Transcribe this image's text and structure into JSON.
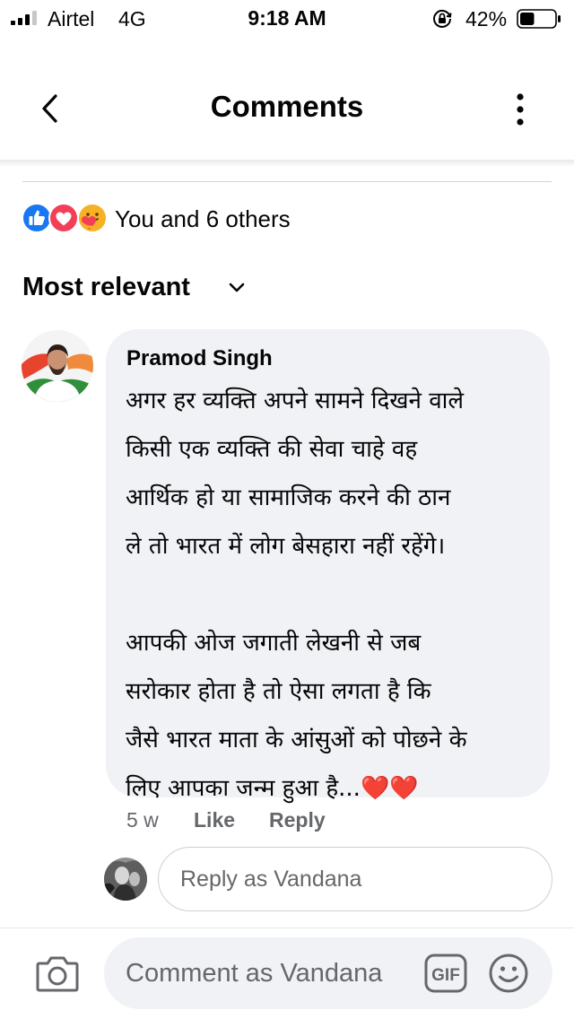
{
  "status_bar": {
    "carrier": "Airtel",
    "network": "4G",
    "time": "9:18 AM",
    "battery_percent": "42%",
    "battery_level": 0.42,
    "signal_bars_filled": 3,
    "signal_bars_total": 4
  },
  "header": {
    "title": "Comments"
  },
  "reactions": {
    "icons": [
      "like-icon",
      "love-icon",
      "care-icon"
    ],
    "text": "You and 6 others"
  },
  "sort": {
    "label": "Most relevant"
  },
  "comment": {
    "author": "Pramod Singh",
    "paragraph1": [
      "अगर हर व्यक्ति अपने सामने दिखने वाले",
      "किसी एक व्यक्ति की सेवा चाहे वह",
      "आर्थिक हो या सामाजिक करने की ठान",
      "ले तो भारत में लोग बेसहारा नहीं रहेंगे।"
    ],
    "paragraph2": [
      "आपकी ओज जगाती लेखनी से जब",
      "सरोकार होता है तो ऐसा लगता है कि",
      "जैसे भारत माता के आंसुओं को पोछने के",
      "लिए आपका जन्म हुआ है..."
    ],
    "hearts": "❤️❤️",
    "time_ago": "5 w",
    "like_label": "Like",
    "reply_label": "Reply"
  },
  "reply": {
    "placeholder": "Reply as Vandana"
  },
  "composer": {
    "placeholder": "Comment as Vandana",
    "gif_label": "GIF"
  },
  "colors": {
    "like_blue": "#1877f2",
    "love_red": "#f33e58",
    "care_yellow": "#f7b125",
    "bubble_gray": "#f0f2f5",
    "meta_gray": "#65676b"
  }
}
